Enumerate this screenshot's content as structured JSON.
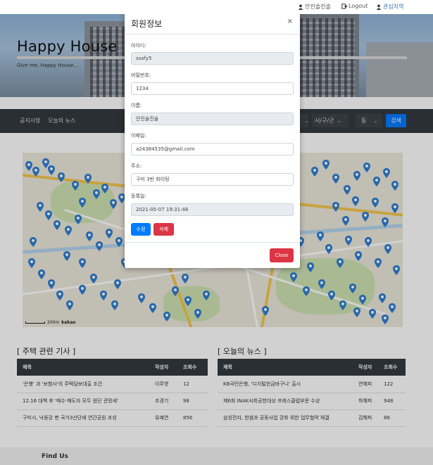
{
  "topbar": {
    "user_name": "안진솔진솔",
    "logout": "Logout",
    "interest": "관심지역"
  },
  "hero": {
    "title": "Happy House",
    "subtitle": "Give me, Happy House..."
  },
  "nav": {
    "notice": "공지사항",
    "news": "오늘의 뉴스",
    "city_select": "시/구/군",
    "dong_select": "동",
    "search": "검색"
  },
  "map": {
    "scale_label": "200m",
    "brand": "kakao"
  },
  "articles": {
    "title": "[ 주택 관련 기사 ]",
    "headers": [
      "제목",
      "작성자",
      "조회수"
    ],
    "rows": [
      {
        "title": "'은행' 과 '보험사'의 주택담보대출 조건",
        "author": "이주영",
        "views": "12"
      },
      {
        "title": "12.16 대책 후 '매수·매도자 모두 원단 관망세'",
        "author": "조경기",
        "views": "98"
      },
      {
        "title": "구미시, 낙동강 변 국가3산단에 연간공원 조성",
        "author": "유예연",
        "views": "856"
      }
    ]
  },
  "news": {
    "title": "[ 오늘의 뉴스 ]",
    "headers": [
      "제목",
      "작성자",
      "조회수"
    ],
    "rows": [
      {
        "title": "KB국민은행, '디지털헌금바구니' 출시",
        "author": "연해피",
        "views": "122"
      },
      {
        "title": "제6회 INAK사회공헌대상 프레스클럽부문 수상",
        "author": "하해피",
        "views": "948"
      },
      {
        "title": "삼성전자, 한샘과 공동사업 강화 위한 업무협약 체결",
        "author": "김해피",
        "views": "86"
      }
    ]
  },
  "footer": {
    "title": "Find Us"
  },
  "modal": {
    "title": "회원정보",
    "close_x": "×",
    "id_label": "아이디:",
    "id_value": "ssafy5",
    "pw_label": "비밀번호:",
    "pw_value": "1234",
    "name_label": "이름:",
    "name_value": "안진솔진솔",
    "email_label": "이메일:",
    "email_value": "a24384535@gmail.com",
    "addr_label": "주소:",
    "addr_value": "구미 3반 화이팅",
    "date_label": "등록일:",
    "date_value": "2021-05-07 19:31:48",
    "edit_button": "수정",
    "delete_button": "삭제",
    "close_button": "Close"
  },
  "colors": {
    "dark": "#343a40",
    "primary": "#007bff",
    "danger": "#dc3545",
    "pin": "#2f7fd2"
  }
}
